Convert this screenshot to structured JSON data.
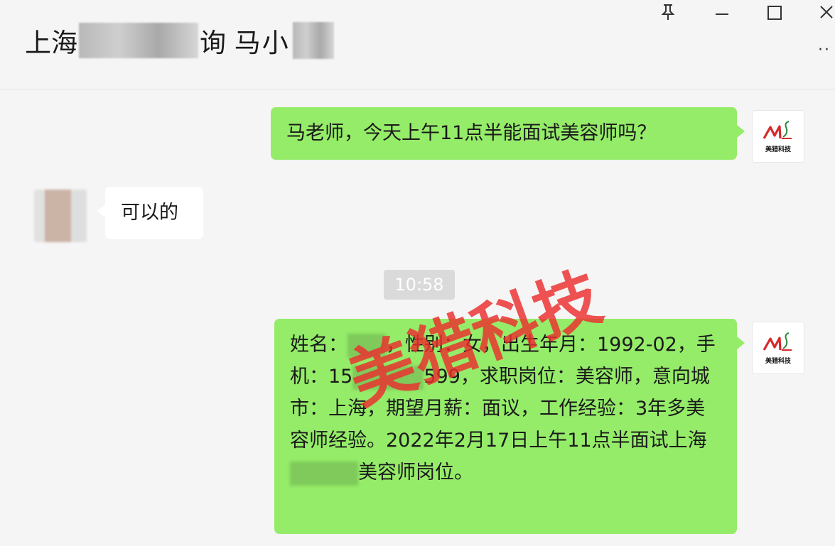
{
  "header": {
    "title_part1": "上海",
    "title_part2": "询 马",
    "title_part3": "小",
    "pin_icon": "pin-icon",
    "minimize_icon": "minimize-icon",
    "maximize_icon": "maximize-icon",
    "close_icon": "close-icon",
    "more_icon": "more-icon"
  },
  "messages": [
    {
      "side": "right",
      "text": "马老师，今天上午11点半能面试美容师吗？"
    },
    {
      "side": "left",
      "text": "可以的"
    },
    {
      "timestamp": "10:58"
    },
    {
      "side": "right",
      "text_a": "姓名：",
      "text_b": "，性别：女，出生年月：1992-02，手机：15",
      "text_c": "599，求职岗位：美容师，意向城市：上海，期望月薪：面议，工作经验：3年多美容师经验。2022年2月17日上午11点半面试上海",
      "text_d": "美容师岗位。"
    }
  ],
  "watermark": "美猎科技",
  "logo": {
    "text": "美猎科技",
    "color": "#d62a2a"
  },
  "colors": {
    "self_bubble": "#95ec69",
    "other_bubble": "#ffffff",
    "background": "#f5f5f5"
  }
}
